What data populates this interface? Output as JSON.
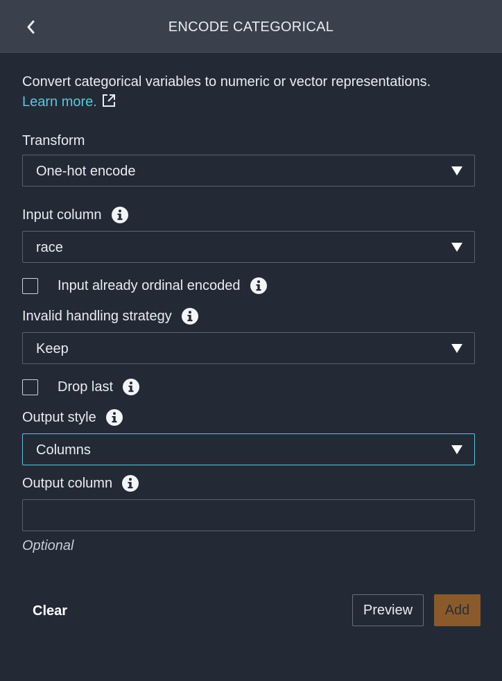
{
  "header": {
    "title": "ENCODE CATEGORICAL",
    "back_icon": "chevron-left-icon"
  },
  "description": {
    "text": "Convert categorical variables to numeric or vector representations.",
    "link_text": "Learn more.",
    "link_icon": "external-link-icon"
  },
  "form": {
    "transform": {
      "label": "Transform",
      "value": "One-hot encode"
    },
    "input_column": {
      "label": "Input column",
      "value": "race"
    },
    "ordinal_checkbox": {
      "label": "Input already ordinal encoded",
      "checked": false
    },
    "invalid_handling": {
      "label": "Invalid handling strategy",
      "value": "Keep"
    },
    "drop_last": {
      "label": "Drop last",
      "checked": false
    },
    "output_style": {
      "label": "Output style",
      "value": "Columns"
    },
    "output_column": {
      "label": "Output column",
      "value": "",
      "hint": "Optional"
    }
  },
  "actions": {
    "clear_label": "Clear",
    "preview_label": "Preview",
    "add_label": "Add"
  },
  "colors": {
    "background": "#232a36",
    "header": "#3a414c",
    "link": "#5fc5dc",
    "focus": "#5fc5dc",
    "add_button": "#8a5a2c"
  }
}
